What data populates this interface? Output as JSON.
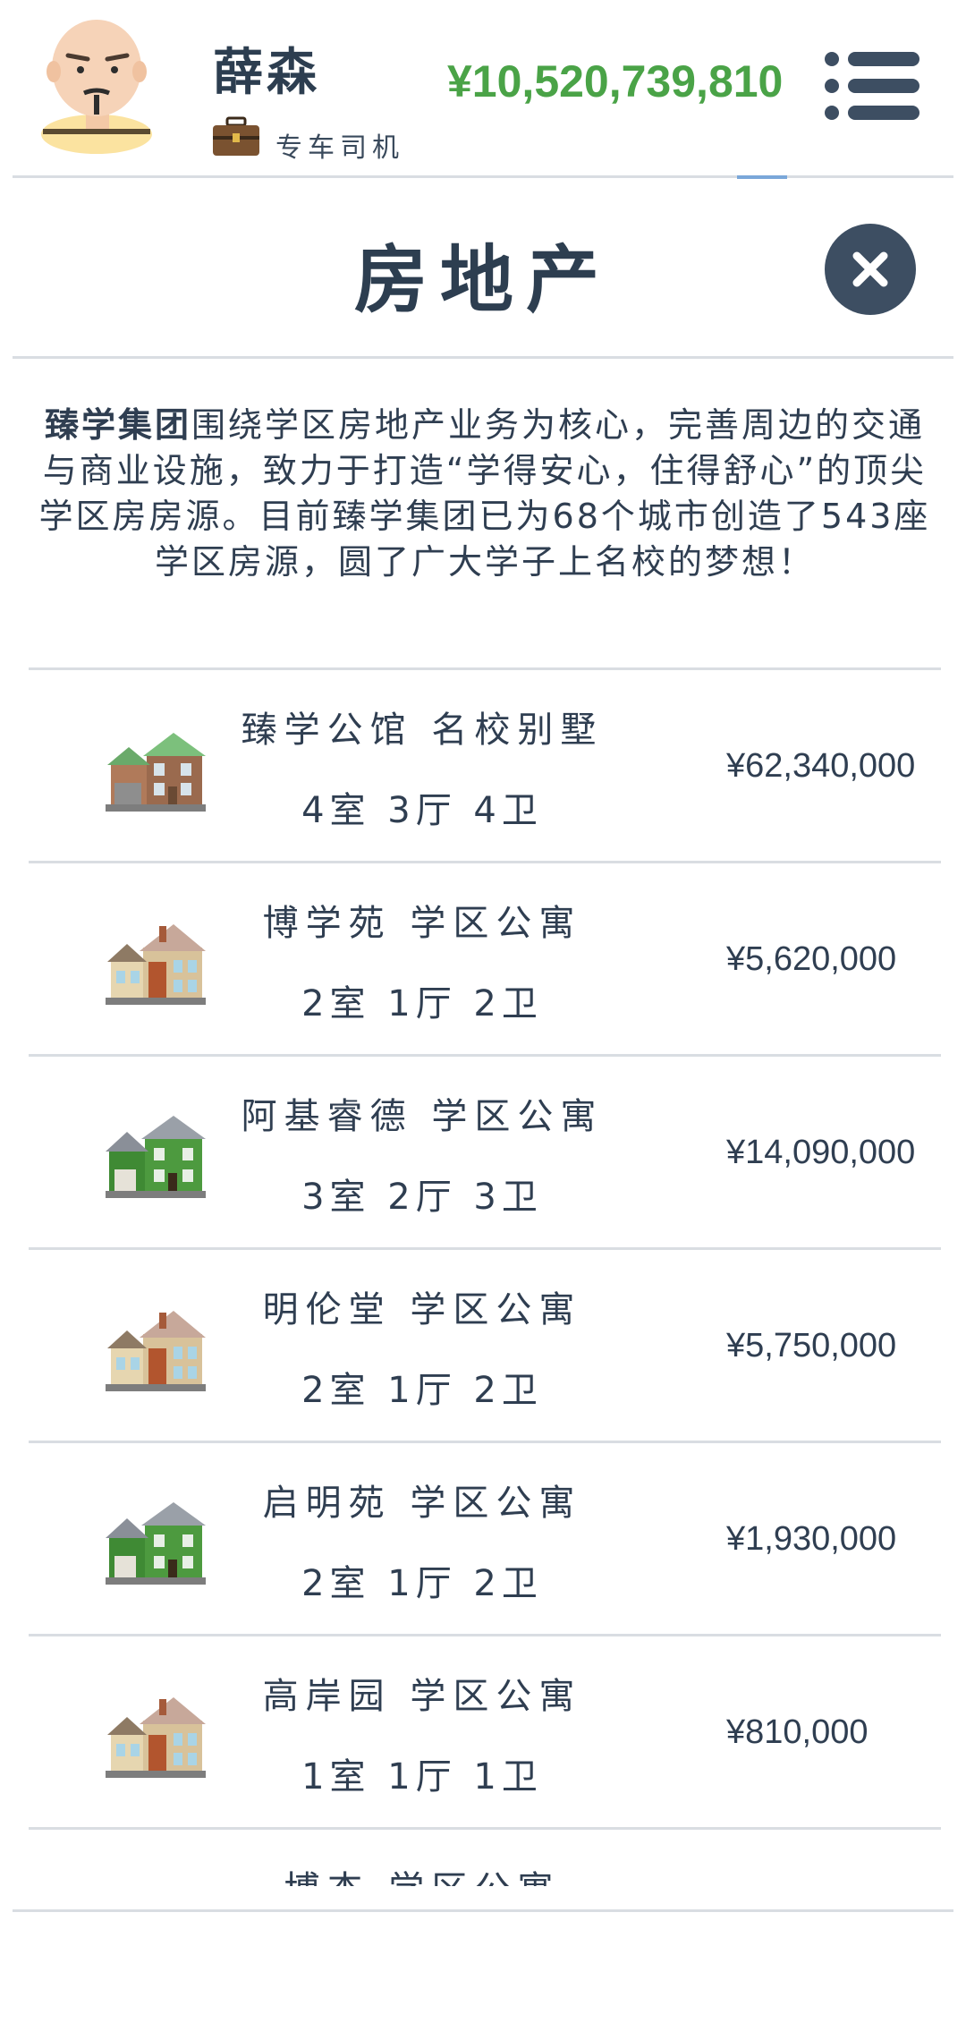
{
  "header": {
    "player_name": "薛森",
    "job_label": "专车司机",
    "money": "¥10,520,739,810",
    "avatar_icon": "avatar-icon",
    "job_icon": "briefcase-icon",
    "menu_icon": "menu-icon"
  },
  "section": {
    "title": "房地产",
    "close_icon": "close-icon"
  },
  "description": {
    "company": "臻学集团",
    "text": "围绕学区房地产业务为核心，完善周边的交通与商业设施，致力于打造“学得安心，住得舒心”的顶尖学区房房源。目前臻学集团已为68个城市创造了543座学区房源，圆了广大学子上名校的梦想！"
  },
  "properties": [
    {
      "name": "臻学公馆 名校别墅",
      "layout": "4室 3厅 4卫",
      "price": "¥62,340,000",
      "icon": "villa-house-icon",
      "style": "villa"
    },
    {
      "name": "博学苑 学区公寓",
      "layout": "2室 1厅 2卫",
      "price": "¥5,620,000",
      "icon": "beige-house-icon",
      "style": "beige"
    },
    {
      "name": "阿基睿德 学区公寓",
      "layout": "3室 2厅 3卫",
      "price": "¥14,090,000",
      "icon": "green-house-icon",
      "style": "green"
    },
    {
      "name": "明伦堂 学区公寓",
      "layout": "2室 1厅 2卫",
      "price": "¥5,750,000",
      "icon": "beige-house-icon",
      "style": "beige"
    },
    {
      "name": "启明苑 学区公寓",
      "layout": "2室 1厅 2卫",
      "price": "¥1,930,000",
      "icon": "green-house-icon",
      "style": "green"
    },
    {
      "name": "高岸园 学区公寓",
      "layout": "1室 1厅 1卫",
      "price": "¥810,000",
      "icon": "beige-house-icon",
      "style": "beige"
    },
    {
      "name": "博杰 学区公寓",
      "layout": "",
      "price": "",
      "icon": "beige-house-icon",
      "style": "beige"
    }
  ],
  "colors": {
    "money": "#4aa347",
    "text": "#2f3e51",
    "close_button": "#3d4e62",
    "divider": "#d9dde2"
  }
}
